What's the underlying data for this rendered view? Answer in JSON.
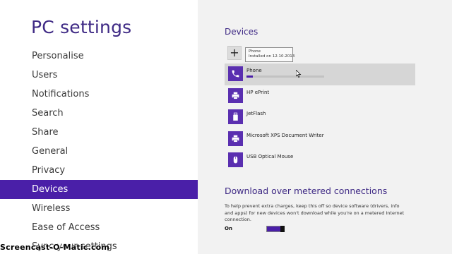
{
  "app": {
    "title": "PC settings"
  },
  "nav": {
    "items": [
      {
        "label": "Personalise"
      },
      {
        "label": "Users"
      },
      {
        "label": "Notifications"
      },
      {
        "label": "Search"
      },
      {
        "label": "Share"
      },
      {
        "label": "General"
      },
      {
        "label": "Privacy"
      },
      {
        "label": "Devices",
        "active": true
      },
      {
        "label": "Wireless"
      },
      {
        "label": "Ease of Access"
      },
      {
        "label": "Sync your settings"
      }
    ]
  },
  "devices": {
    "title": "Devices",
    "add_icon": "plus-icon",
    "tooltip": {
      "line1": "Phone",
      "line2": "Installed on 12.10.2013"
    },
    "items": [
      {
        "name": "Phone",
        "icon": "phone-icon",
        "selected": true,
        "install_progress": 0.08
      },
      {
        "name": "HP ePrint",
        "icon": "printer-icon"
      },
      {
        "name": "JetFlash",
        "icon": "usb-drive-icon"
      },
      {
        "name": "Microsoft XPS Document Writer",
        "icon": "printer-icon"
      },
      {
        "name": "USB Optical Mouse",
        "icon": "mouse-icon"
      }
    ]
  },
  "metered": {
    "title": "Download over metered connections",
    "description": "To help prevent extra charges, keep this off so device software (drivers, info and apps) for new devices won't download while you're on a metered Internet connection.",
    "toggle_label": "On",
    "toggle_on": true
  },
  "watermark": {
    "text": "Screencast-O-Matic.com"
  },
  "colors": {
    "accent": "#4a1fa8",
    "title": "#3f2a85",
    "right_pane_bg": "#f2f2f2"
  }
}
